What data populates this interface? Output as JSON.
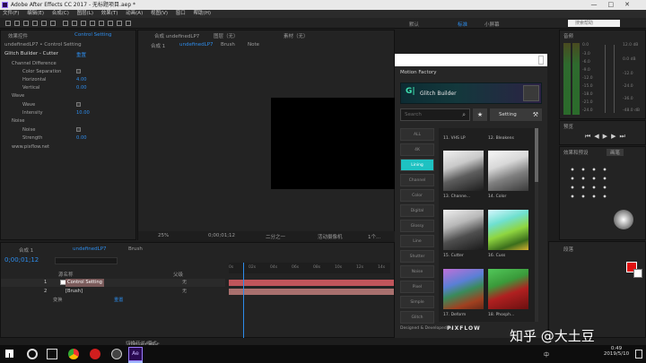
{
  "window": {
    "title": "Adobe After Effects CC 2017 - 无标题项目.aep *"
  },
  "menu": [
    "文件(F)",
    "编辑(E)",
    "合成(C)",
    "图层(L)",
    "效果(T)",
    "动画(A)",
    "视图(V)",
    "窗口",
    "帮助(H)"
  ],
  "toolbar": {
    "workspace_default": "默认",
    "workspace_standard": "标准",
    "workspace_small": "小屏幕",
    "search_placeholder": "搜索帮助"
  },
  "effects_panel": {
    "tab": "效果控件",
    "tab_label": "Control Setting",
    "breadcrumb": "undefinedLP7 • Control Setting",
    "effect_name": "Glitch Builder - Cutter",
    "reset": "重置",
    "groups": [
      {
        "label": "Channel Difference"
      },
      {
        "label": "Color Separation"
      },
      {
        "label": "Horizontal",
        "value": "4.00"
      },
      {
        "label": "Vertical",
        "value": "0.00"
      },
      {
        "label": "Wave"
      },
      {
        "label": "Wave"
      },
      {
        "label": "Intensity",
        "value": "10.00"
      },
      {
        "label": "Noise"
      },
      {
        "label": "Noise"
      },
      {
        "label": "Strength",
        "value": "0.00"
      },
      {
        "label": "www.pixflow.net"
      }
    ]
  },
  "comp_panel": {
    "tab": "合成 undefinedLP7",
    "layer_tab": "图层（无）",
    "footage_tab": "素材（无）",
    "sub_tabs": [
      "合成 1",
      "undefinedLP7",
      "Brush",
      "Note"
    ],
    "zoom": "25%",
    "timecode": "0;00;01;12",
    "quality": "二分之一",
    "camera": "活动摄像机",
    "views": "1个..."
  },
  "motion_factory": {
    "title": "Motion Factory",
    "plugin": "Glitch Builder",
    "search_placeholder": "Search",
    "setting": "Setting",
    "categories": [
      "ALL",
      "4K",
      "Lining",
      "Channel",
      "Color",
      "Digital",
      "Glossy",
      "Line",
      "Shutter",
      "Noise",
      "Pixel",
      "Simple",
      "Glitch"
    ],
    "active_category": "Lining",
    "presets": [
      {
        "caption": "11. VHS LP"
      },
      {
        "caption": "12. Bleakens"
      },
      {
        "caption": "13. Channe..."
      },
      {
        "caption": "14. Color"
      },
      {
        "caption": "15. Cutter"
      },
      {
        "caption": "16. Cuss"
      },
      {
        "caption": "17. Deform"
      },
      {
        "caption": "18. Phosph..."
      }
    ],
    "footer": "Designed & Developed by",
    "brand": "PIXFLOW"
  },
  "audio_panel": {
    "title": "音频",
    "scale": [
      "0.0",
      "-3.0",
      "-6.0",
      "-9.0",
      "-12.0",
      "-15.0",
      "-18.0",
      "-21.0",
      "-24.0"
    ],
    "db_right": [
      "12.0 dB",
      "0.0 dB",
      "-12.0",
      "-24.0",
      "-36.0",
      "-48.0 dB"
    ]
  },
  "preview_panel": {
    "title": "预览"
  },
  "tracker_panel": {
    "title": "效果和预设",
    "sub": "画笔"
  },
  "paragraph_panel": {
    "title": "段落"
  },
  "timeline": {
    "tabs": [
      "合成 1",
      "undefinedLP7",
      "Brush"
    ],
    "timecode": "0;00;01;12",
    "columns": {
      "name": "源名称",
      "parent": "父级"
    },
    "rows": [
      {
        "num": "1",
        "name": "Control Setting",
        "parent": "无"
      },
      {
        "num": "2",
        "name": "[Brush]",
        "parent": "无"
      },
      {
        "num": "",
        "name": "变换",
        "parent": "重置"
      }
    ],
    "ruler": [
      "0s",
      "02s",
      "04s",
      "06s",
      "08s",
      "10s",
      "12s",
      "14s"
    ],
    "footer": "切换开关/模式"
  },
  "taskbar": {
    "time": "0:49",
    "date": "2019/5/10",
    "lang": "中"
  },
  "watermark": "知乎 @大土豆",
  "colors": {
    "accent": "#2d8ceb",
    "layer1": "#c0555b",
    "layer2": "#a8706e",
    "playhead": "#2d8ceb"
  }
}
